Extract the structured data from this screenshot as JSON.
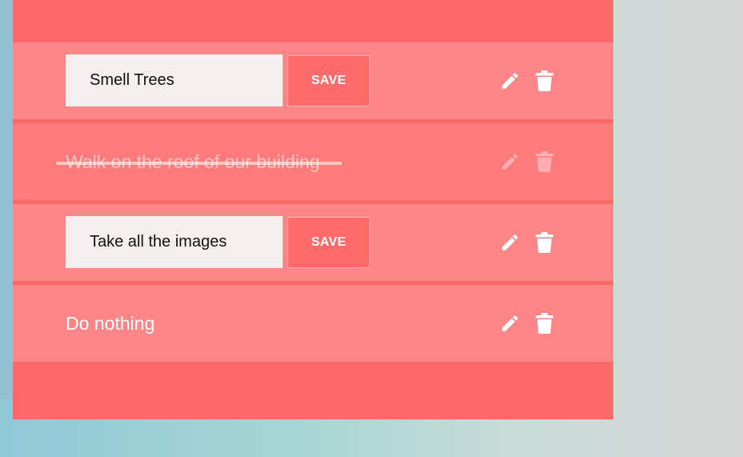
{
  "colors": {
    "card": "#ff6868",
    "row": "#ff8686",
    "completed_row": "#ff7a7a",
    "input_bg": "#f5efef",
    "save_bg": "#ff6a6a"
  },
  "icons": {
    "edit": "pencil-icon",
    "delete": "trash-icon"
  },
  "todos": [
    {
      "state": "editing",
      "value": "Smell Trees",
      "save_label": "SAVE"
    },
    {
      "state": "completed",
      "text": "Walk on the roof of our building"
    },
    {
      "state": "editing",
      "value": "Take all the images",
      "save_label": "SAVE"
    },
    {
      "state": "active",
      "text": "Do nothing"
    }
  ]
}
